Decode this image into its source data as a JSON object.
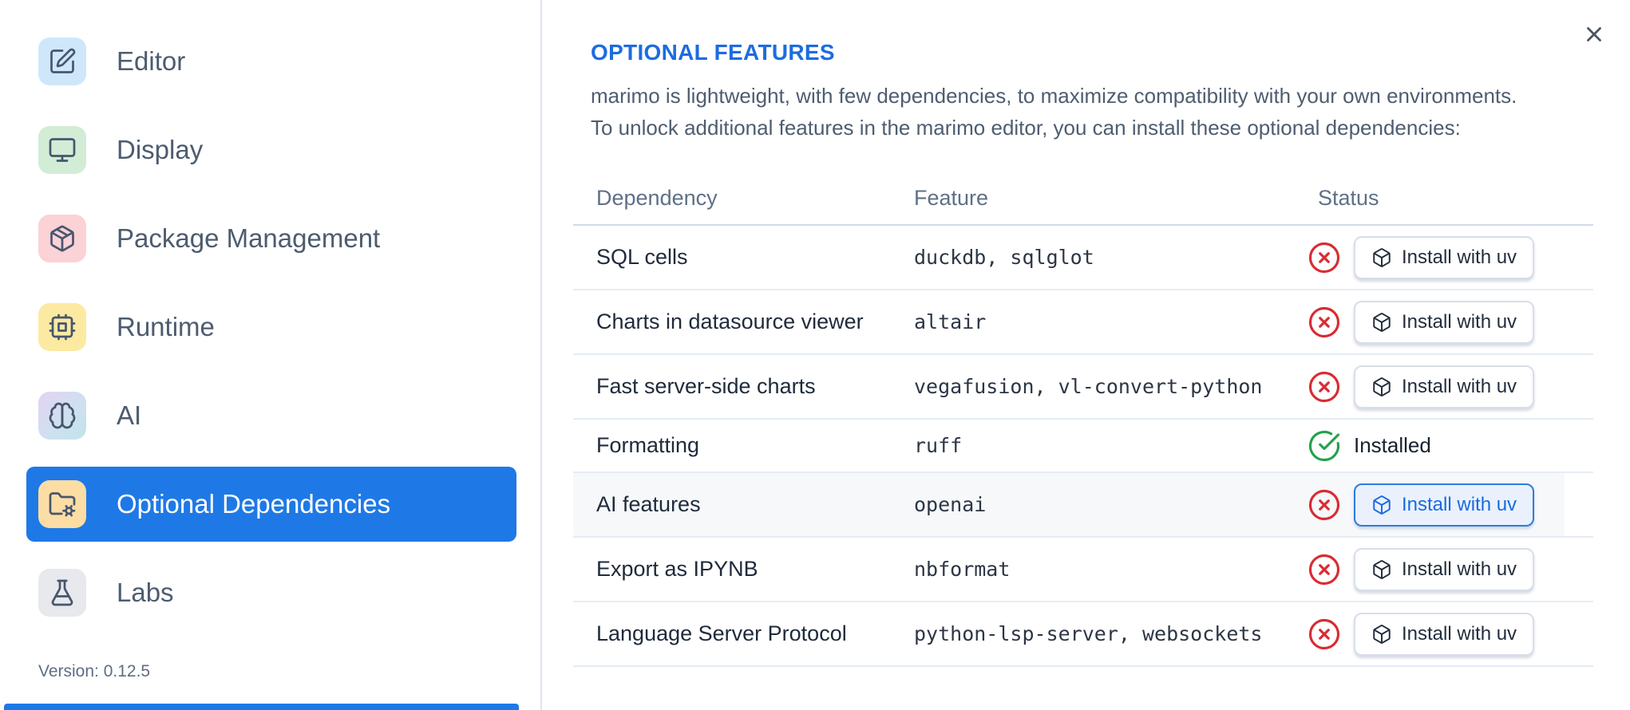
{
  "sidebar": {
    "items": [
      {
        "label": "Editor",
        "icon": "square-pen",
        "icon_bg": "#cfe7fb",
        "selected": false
      },
      {
        "label": "Display",
        "icon": "monitor",
        "icon_bg": "#d2ecd6",
        "selected": false
      },
      {
        "label": "Package Management",
        "icon": "package",
        "icon_bg": "#fbd2d6",
        "selected": false
      },
      {
        "label": "Runtime",
        "icon": "cpu",
        "icon_bg": "#fceaa2",
        "selected": false
      },
      {
        "label": "AI",
        "icon": "brain",
        "icon_bg": "linear-gradient(135deg,#e4d3f3 0%,#cfe0f0 55%,#c2e4e9 100%)",
        "selected": false
      },
      {
        "label": "Optional Dependencies",
        "icon": "folder-cog",
        "icon_bg": "#fcdda4",
        "selected": true
      },
      {
        "label": "Labs",
        "icon": "flask",
        "icon_bg": "#e7e9ec",
        "selected": false
      }
    ],
    "version_label": "Version: 0.12.5"
  },
  "main": {
    "title": "OPTIONAL FEATURES",
    "description_lines": [
      "marimo is lightweight, with few dependencies, to maximize compatibility with your own environments.",
      "To unlock additional features in the marimo editor, you can install these optional dependencies:"
    ],
    "table": {
      "headers": [
        "Dependency",
        "Feature",
        "Status"
      ],
      "install_button_label": "Install with uv",
      "rows": [
        {
          "dependency": "SQL cells",
          "feature": "duckdb, sqlglot",
          "status": "not_installed",
          "highlighted": false,
          "focused": false
        },
        {
          "dependency": "Charts in datasource viewer",
          "feature": "altair",
          "status": "not_installed",
          "highlighted": false,
          "focused": false
        },
        {
          "dependency": "Fast server-side charts",
          "feature": "vegafusion, vl-convert-python",
          "status": "not_installed",
          "highlighted": false,
          "focused": false
        },
        {
          "dependency": "Formatting",
          "feature": "ruff",
          "status": "installed",
          "status_label": "Installed",
          "highlighted": false,
          "focused": false
        },
        {
          "dependency": "AI features",
          "feature": "openai",
          "status": "not_installed",
          "highlighted": true,
          "focused": true
        },
        {
          "dependency": "Export as IPYNB",
          "feature": "nbformat",
          "status": "not_installed",
          "highlighted": false,
          "focused": false
        },
        {
          "dependency": "Language Server Protocol",
          "feature": "python-lsp-server, websockets",
          "status": "not_installed",
          "highlighted": false,
          "focused": false
        }
      ]
    }
  },
  "colors": {
    "accent_blue": "#1e79e6",
    "title_blue": "#1c6ce0",
    "error_red": "#d92b33",
    "success_green": "#23a24b",
    "divider": "#dde4ef",
    "row_highlight": "#f6f8fa"
  }
}
